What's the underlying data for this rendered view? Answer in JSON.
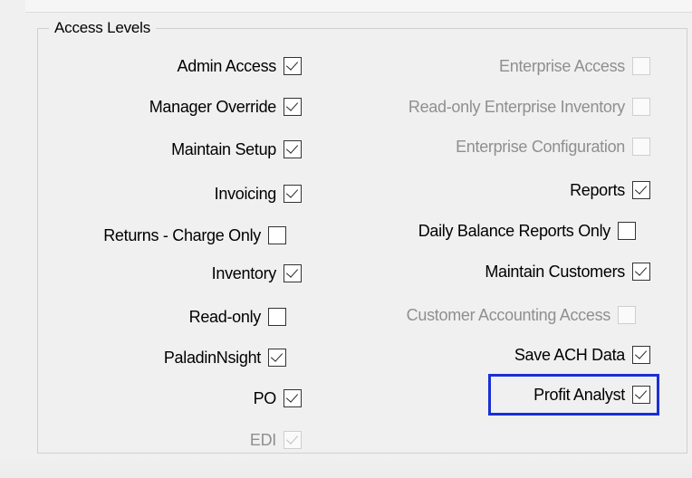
{
  "group": {
    "title": "Access Levels"
  },
  "left_column": [
    {
      "label": "Admin Access",
      "checked": true,
      "enabled": true
    },
    {
      "label": "Manager Override",
      "checked": true,
      "enabled": true
    },
    {
      "label": "Maintain Setup",
      "checked": true,
      "enabled": true
    },
    {
      "label": "Invoicing",
      "checked": true,
      "enabled": true
    },
    {
      "label": "Returns - Charge Only",
      "checked": false,
      "enabled": true
    },
    {
      "label": "Inventory",
      "checked": true,
      "enabled": true
    },
    {
      "label": "Read-only",
      "checked": false,
      "enabled": true
    },
    {
      "label": "PaladinNsight",
      "checked": true,
      "enabled": true
    },
    {
      "label": "PO",
      "checked": true,
      "enabled": true
    },
    {
      "label": "EDI",
      "checked": true,
      "enabled": false
    }
  ],
  "right_column": [
    {
      "label": "Enterprise Access",
      "checked": false,
      "enabled": false
    },
    {
      "label": "Read-only Enterprise Inventory",
      "checked": false,
      "enabled": false
    },
    {
      "label": "Enterprise Configuration",
      "checked": false,
      "enabled": false
    },
    {
      "label": "Reports",
      "checked": true,
      "enabled": true
    },
    {
      "label": "Daily Balance Reports Only",
      "checked": false,
      "enabled": true
    },
    {
      "label": "Maintain Customers",
      "checked": true,
      "enabled": true
    },
    {
      "label": "Customer Accounting Access",
      "checked": false,
      "enabled": false
    },
    {
      "label": "Save ACH Data",
      "checked": true,
      "enabled": true
    },
    {
      "label": "Profit Analyst",
      "checked": true,
      "enabled": true,
      "highlighted": true
    }
  ],
  "colors": {
    "highlight": "#1a2fd6",
    "disabled_text": "#8f8f8f",
    "background": "#f0f0f0"
  }
}
